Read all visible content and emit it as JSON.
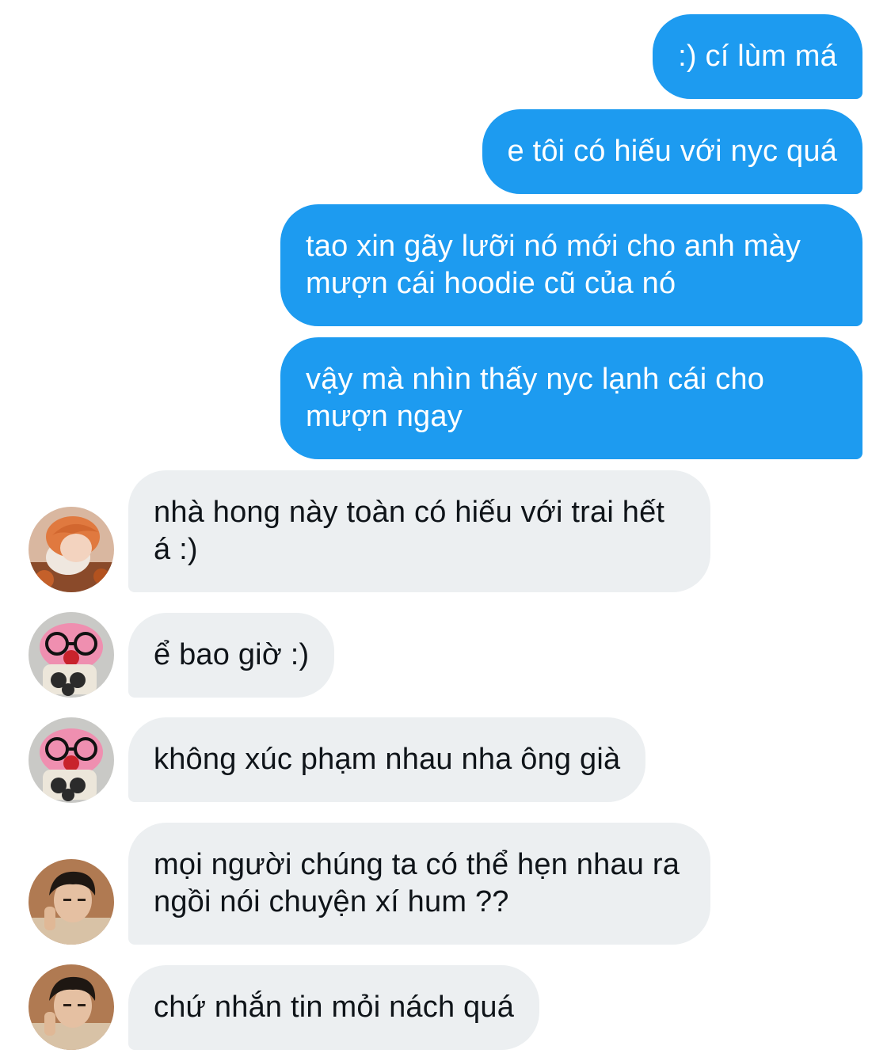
{
  "colors": {
    "outgoing_bubble": "#1d9bf0",
    "incoming_bubble": "#eceff1",
    "outgoing_text": "#ffffff",
    "incoming_text": "#0f1419"
  },
  "messages": [
    {
      "side": "outgoing",
      "text": ":) cí lùm má"
    },
    {
      "side": "outgoing",
      "text": "e tôi có hiếu với nyc quá"
    },
    {
      "side": "outgoing",
      "text": "tao xin gãy lưỡi nó mới cho anh mày mượn cái hoodie cũ của nó"
    },
    {
      "side": "outgoing",
      "text": "vậy mà nhìn thấy nyc lạnh cái cho mượn ngay"
    },
    {
      "side": "incoming",
      "avatar": "orange-hair-person-avatar",
      "text": "nhà hong này toàn có hiếu với trai hết á :)"
    },
    {
      "side": "incoming",
      "avatar": "pink-plush-glasses-avatar",
      "text": "ể bao giờ :)"
    },
    {
      "side": "incoming",
      "avatar": "pink-plush-glasses-avatar",
      "text": "không xúc phạm nhau nha ông già"
    },
    {
      "side": "incoming",
      "avatar": "dark-hair-person-avatar",
      "text": "mọi người chúng ta có thể hẹn nhau ra ngồi nói chuyện xí hum ??"
    },
    {
      "side": "incoming",
      "avatar": "dark-hair-person-avatar",
      "text": "chứ nhắn tin mỏi nách quá"
    }
  ]
}
